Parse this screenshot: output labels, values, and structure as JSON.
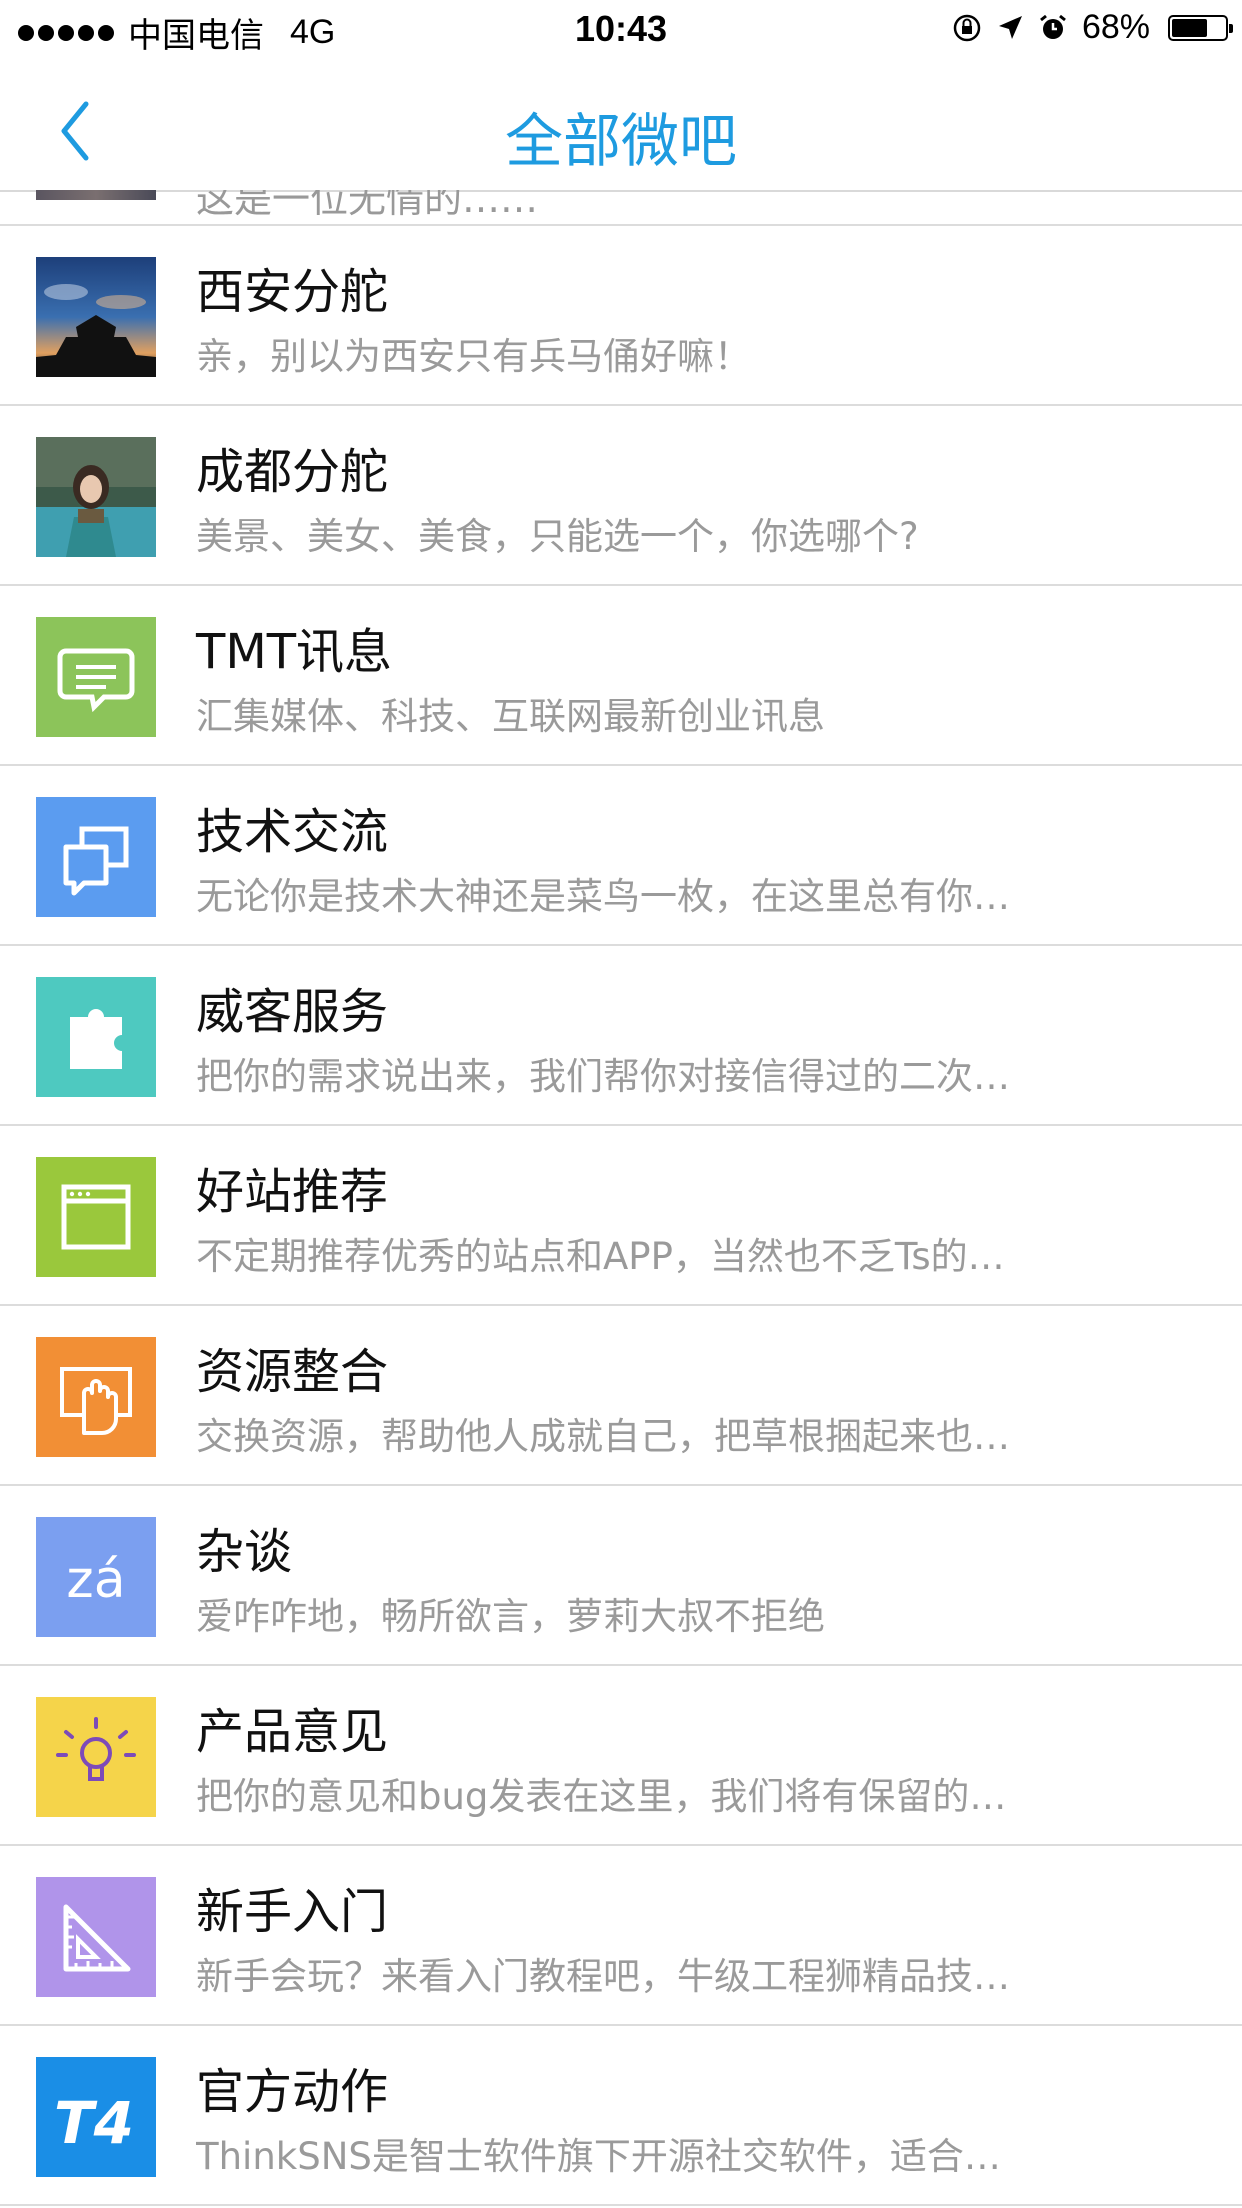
{
  "status": {
    "carrier": "中国电信",
    "network": "4G",
    "time": "10:43",
    "battery": "68%",
    "battery_level": 0.68
  },
  "nav": {
    "title": "全部微吧"
  },
  "partial_row": {
    "desc": "这是一位无情的……"
  },
  "items": [
    {
      "title": "西安分舵",
      "desc": "亲，别以为西安只有兵马俑好嘛！",
      "icon": "xian-photo",
      "color": "#2b4a7a"
    },
    {
      "title": "成都分舵",
      "desc": "美景、美女、美食，只能选一个，你选哪个?",
      "icon": "chengdu-photo",
      "color": "#4a7a6a"
    },
    {
      "title": "TMT讯息",
      "desc": "汇集媒体、科技、互联网最新创业讯息",
      "icon": "message-icon",
      "color": "#8cc45a"
    },
    {
      "title": "技术交流",
      "desc": "无论你是技术大神还是菜鸟一枚，在这里总有你…",
      "icon": "chat-bubbles-icon",
      "color": "#5b9cf0"
    },
    {
      "title": "威客服务",
      "desc": "把你的需求说出来，我们帮你对接信得过的二次…",
      "icon": "puzzle-icon",
      "color": "#4ec9c0"
    },
    {
      "title": "好站推荐",
      "desc": "不定期推荐优秀的站点和APP，当然也不乏Ts的…",
      "icon": "browser-icon",
      "color": "#9ac83c"
    },
    {
      "title": "资源整合",
      "desc": "交换资源，帮助他人成就自己，把草根捆起来也…",
      "icon": "hand-icon",
      "color": "#f28f35"
    },
    {
      "title": "杂谈",
      "desc": "爱咋咋地，畅所欲言，萝莉大叔不拒绝",
      "icon": "za-icon",
      "color": "#7b9ff0",
      "icon_text": "zá"
    },
    {
      "title": "产品意见",
      "desc": "把你的意见和bug发表在这里，我们将有保留的…",
      "icon": "lightbulb-icon",
      "color": "#f5d44a"
    },
    {
      "title": "新手入门",
      "desc": "新手会玩？来看入门教程吧，牛级工程狮精品技…",
      "icon": "ruler-icon",
      "color": "#b094ea"
    },
    {
      "title": "官方动作",
      "desc": "ThinkSNS是智士软件旗下开源社交软件，适合…",
      "icon": "t4-logo-icon",
      "color": "#1a8ee6",
      "icon_text": "T4"
    }
  ]
}
